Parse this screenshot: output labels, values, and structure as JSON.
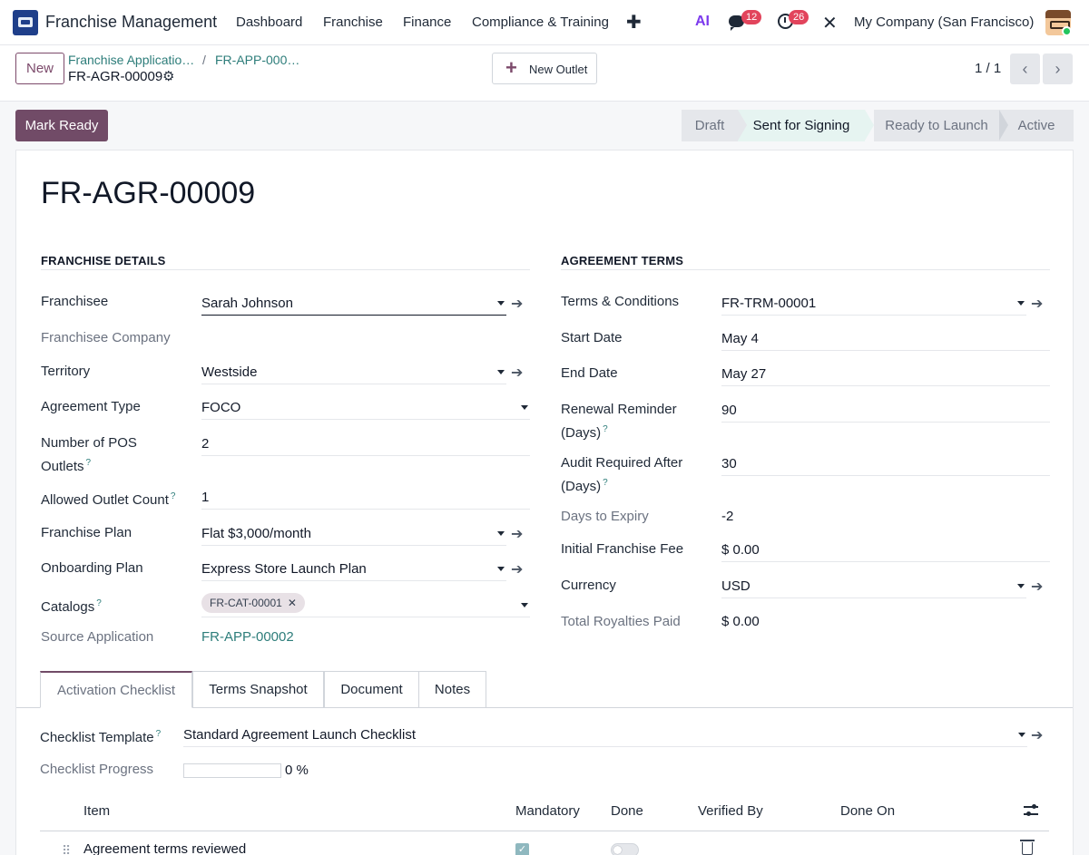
{
  "navbar": {
    "app_name": "Franchise Management",
    "menu": [
      "Dashboard",
      "Franchise",
      "Finance",
      "Compliance & Training"
    ],
    "plus": "✚",
    "ai_icon": "AI",
    "messages_count": "12",
    "activities_count": "26",
    "company": "My Company (San Francisco)"
  },
  "control": {
    "new_label": "New",
    "breadcrumb_parent": "Franchise Applicatio…",
    "breadcrumb_sep": "/",
    "breadcrumb_current": "FR-APP-000…",
    "record_name": "FR-AGR-00009",
    "new_outlet_label": "New Outlet",
    "pager": "1 / 1"
  },
  "status": {
    "mark_ready_label": "Mark Ready",
    "steps": [
      "Draft",
      "Sent for Signing",
      "Ready to Launch",
      "Active"
    ],
    "active_step": "Sent for Signing"
  },
  "form": {
    "title": "FR-AGR-00009",
    "left_group": {
      "title": "FRANCHISE DETAILS",
      "franchisee_label": "Franchisee",
      "franchisee": "Sarah Johnson",
      "franchisee_company_label": "Franchisee Company",
      "territory_label": "Territory",
      "territory": "Westside",
      "agreement_type_label": "Agreement Type",
      "agreement_type": "FOCO",
      "pos_label_1": "Number of POS",
      "pos_label_2": "Outlets",
      "pos": "2",
      "allowed_label": "Allowed Outlet Count",
      "allowed": "1",
      "plan_label": "Franchise Plan",
      "plan": "Flat $3,000/month",
      "onboarding_label": "Onboarding Plan",
      "onboarding": "Express Store Launch Plan",
      "catalogs_label": "Catalogs",
      "catalog_tag": "FR-CAT-00001",
      "source_label": "Source Application",
      "source": "FR-APP-00002"
    },
    "right_group": {
      "title": "AGREEMENT TERMS",
      "terms_label": "Terms & Conditions",
      "terms": "FR-TRM-00001",
      "start_label": "Start Date",
      "start": "May 4",
      "end_label": "End Date",
      "end": "May 27",
      "renewal_label_1": "Renewal Reminder",
      "renewal_label_2": "(Days)",
      "renewal": "90",
      "audit_label_1": "Audit Required After",
      "audit_label_2": "(Days)",
      "audit": "30",
      "expiry_label": "Days to Expiry",
      "expiry": "-2",
      "fee_label": "Initial Franchise Fee",
      "fee": "$ 0.00",
      "currency_label": "Currency",
      "currency": "USD",
      "royalties_label": "Total Royalties Paid",
      "royalties": "$ 0.00"
    },
    "help_mark": "?"
  },
  "tabs": [
    "Activation Checklist",
    "Terms Snapshot",
    "Document",
    "Notes"
  ],
  "checklist": {
    "template_label": "Checklist Template",
    "template": "Standard Agreement Launch Checklist",
    "progress_label": "Checklist Progress",
    "progress_value": 0,
    "progress_text": "0 %",
    "columns": [
      "Item",
      "Mandatory",
      "Done",
      "Verified By",
      "Done On"
    ],
    "rows": [
      {
        "item": "Agreement terms reviewed",
        "mandatory": true,
        "done": false
      }
    ]
  },
  "colors": {
    "brand": "#714b67",
    "link": "#2d7d7a",
    "badge": "#e2445c"
  }
}
